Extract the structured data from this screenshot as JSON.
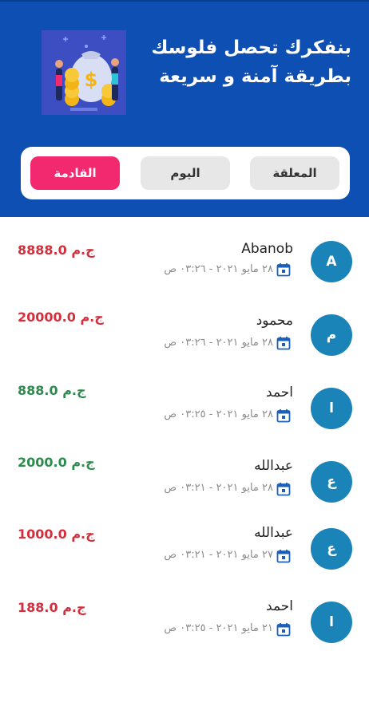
{
  "header": {
    "bg_color": "#0d4fb2",
    "title_line1": "بنفكرك تحصل فلوسك",
    "title_line2": "بطريقة آمنة و سريعة",
    "illustration": "money-bag-illustration",
    "illustration_caption": "investment"
  },
  "tabs": [
    {
      "label": "المعلقة",
      "active": false
    },
    {
      "label": "اليوم",
      "active": false
    },
    {
      "label": "القادمة",
      "active": true
    }
  ],
  "accent_color": "#f2296e",
  "transactions": [
    {
      "initial": "A",
      "name": "Abanob",
      "date": "٢٨ مايو ٢٠٢١ - ٠٣:٢٦ ص",
      "amount": "8888.0",
      "currency": "ج.م",
      "color": "#d32f3c"
    },
    {
      "initial": "م",
      "name": "محمود",
      "date": "٢٨ مايو ٢٠٢١ - ٠٣:٢٦ ص",
      "amount": "20000.0",
      "currency": "ج.م",
      "color": "#d32f3c"
    },
    {
      "initial": "ا",
      "name": "احمد",
      "date": "٢٨ مايو ٢٠٢١ - ٠٣:٢٥ ص",
      "amount": "888.0",
      "currency": "ج.م",
      "color": "#2e8b4e"
    },
    {
      "initial": "ع",
      "name": "عبدالله",
      "date": "٢٨ مايو ٢٠٢١ - ٠٣:٢١ ص",
      "amount": "2000.0",
      "currency": "ج.م",
      "color": "#2e8b4e"
    },
    {
      "initial": "ع",
      "name": "عبدالله",
      "date": "٢٧ مايو ٢٠٢١ - ٠٣:٢١ ص",
      "amount": "1000.0",
      "currency": "ج.م",
      "color": "#d32f3c"
    },
    {
      "initial": "ا",
      "name": "احمد",
      "date": "٢١ مايو ٢٠٢١ - ٠٣:٢٥ ص",
      "amount": "188.0",
      "currency": "ج.م",
      "color": "#d32f3c"
    }
  ]
}
